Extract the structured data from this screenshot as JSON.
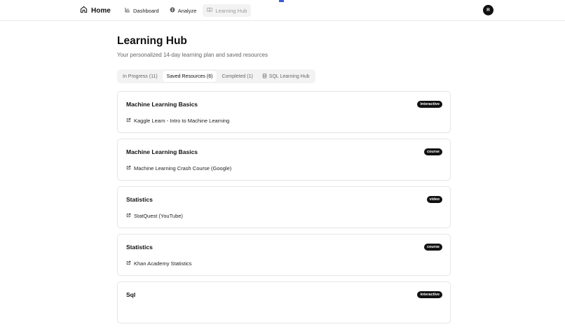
{
  "header": {
    "home_label": "Home",
    "nav": [
      {
        "label": "Dashboard",
        "icon": "bar-chart-icon"
      },
      {
        "label": "Analyze",
        "icon": "globe-icon"
      },
      {
        "label": "Learning Hub",
        "icon": "book-icon",
        "active": true
      }
    ],
    "avatar_initial": "R"
  },
  "page": {
    "title": "Learning Hub",
    "subtitle": "Your personalized 14-day learning plan and saved resources"
  },
  "tabs": [
    {
      "label": "In Progress (11)"
    },
    {
      "label": "Saved Resources (6)",
      "active": true
    },
    {
      "label": "Completed (1)"
    },
    {
      "label": "SQL Learning Hub",
      "icon": "database-icon"
    }
  ],
  "resources": [
    {
      "topic": "Machine Learning Basics",
      "type": "interactive",
      "link": "Kaggle Learn - Intro to Machine Learning"
    },
    {
      "topic": "Machine Learning Basics",
      "type": "course",
      "link": "Machine Learning Crash Course (Google)"
    },
    {
      "topic": "Statistics",
      "type": "video",
      "link": "StatQuest (YouTube)"
    },
    {
      "topic": "Statistics",
      "type": "course",
      "link": "Khan Academy Statistics"
    },
    {
      "topic": "Sql",
      "type": "interactive",
      "link": ""
    }
  ],
  "colors": {
    "accent": "#3b5bdb",
    "badge_bg": "#111111",
    "tab_bar_bg": "#f3f3f3"
  }
}
